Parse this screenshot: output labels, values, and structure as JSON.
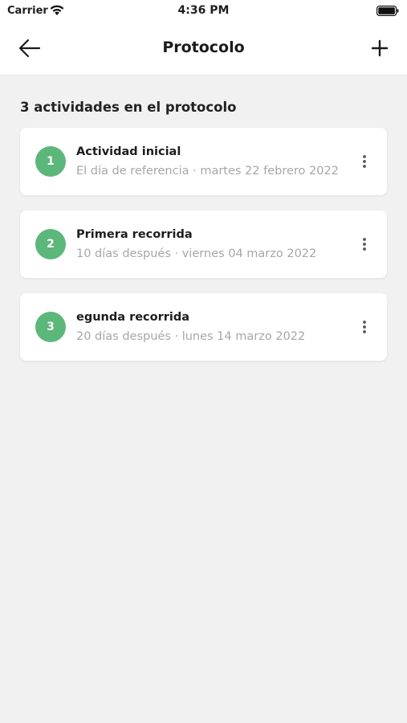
{
  "status_bar": {
    "carrier": "Carrier",
    "time": "4:36 PM",
    "icons": [
      "wifi-icon",
      "battery-icon"
    ]
  },
  "nav": {
    "title": "Protocolo",
    "back_icon": "arrow-left-icon",
    "add_icon": "plus-icon"
  },
  "section": {
    "heading": "3 actividades en el protocolo"
  },
  "activities": [
    {
      "number": "1",
      "title": "Actividad inicial",
      "subtitle": "El día de referencia · martes 22 febrero 2022"
    },
    {
      "number": "2",
      "title": "Primera recorrida",
      "subtitle": "10 días después · viernes 04 marzo 2022"
    },
    {
      "number": "3",
      "title": "egunda recorrida",
      "subtitle": "20 días después · lunes 14 marzo 2022"
    }
  ],
  "colors": {
    "accent_green": "#5cb77a",
    "background": "#f1f1f1",
    "card": "#ffffff",
    "subtitle_gray": "#a7a7a7"
  }
}
